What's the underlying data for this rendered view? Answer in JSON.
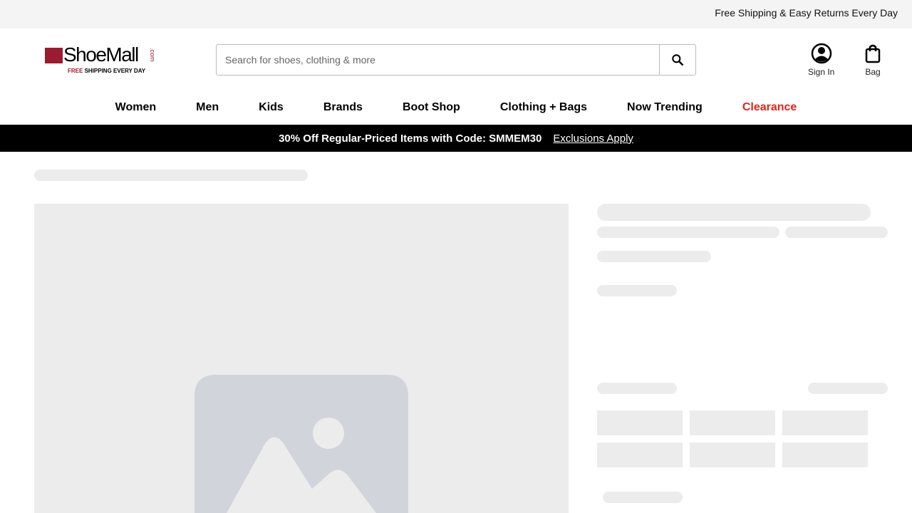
{
  "topbar": {
    "message": "Free Shipping & Easy Returns Every Day"
  },
  "logo": {
    "name": "ShoeMall",
    "suffix": ".com",
    "tagline_highlight": "FREE",
    "tagline_rest": " SHIPPING EVERY DAY",
    "brand_color": "#9b1b30"
  },
  "search": {
    "placeholder": "Search for shoes, clothing & more",
    "value": ""
  },
  "account": {
    "sign_in": "Sign In",
    "bag": "Bag"
  },
  "nav": {
    "items": [
      "Women",
      "Men",
      "Kids",
      "Brands",
      "Boot Shop",
      "Clothing + Bags",
      "Now Trending",
      "Clearance"
    ],
    "clearance_color": "#e2231a"
  },
  "promo": {
    "text": "30% Off Regular-Priced Items with Code: SMMEM30",
    "link": "Exclusions Apply"
  }
}
